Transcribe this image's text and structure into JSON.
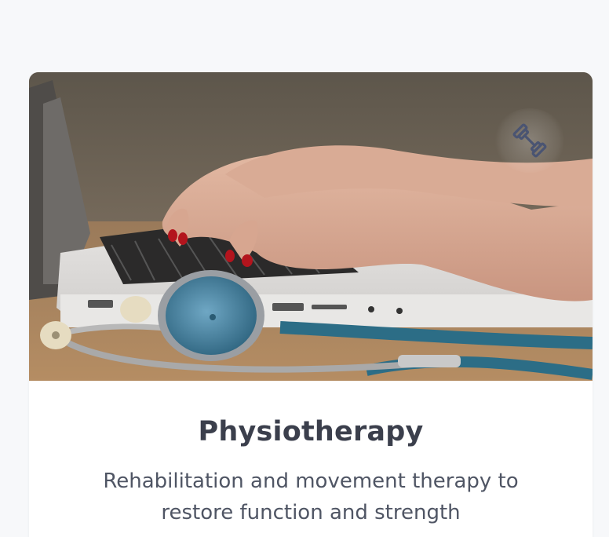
{
  "card": {
    "title": "Physiotherapy",
    "description": "Rehabilitation and movement therapy to restore function and strength",
    "icon": "dumbbell-icon",
    "image": "laptop-hands-stethoscope-photo"
  },
  "colors": {
    "page_background": "#f7f8fa",
    "card_background": "#ffffff",
    "title": "#3b3f4c",
    "description": "#4f5564",
    "icon": "#4a5472"
  }
}
